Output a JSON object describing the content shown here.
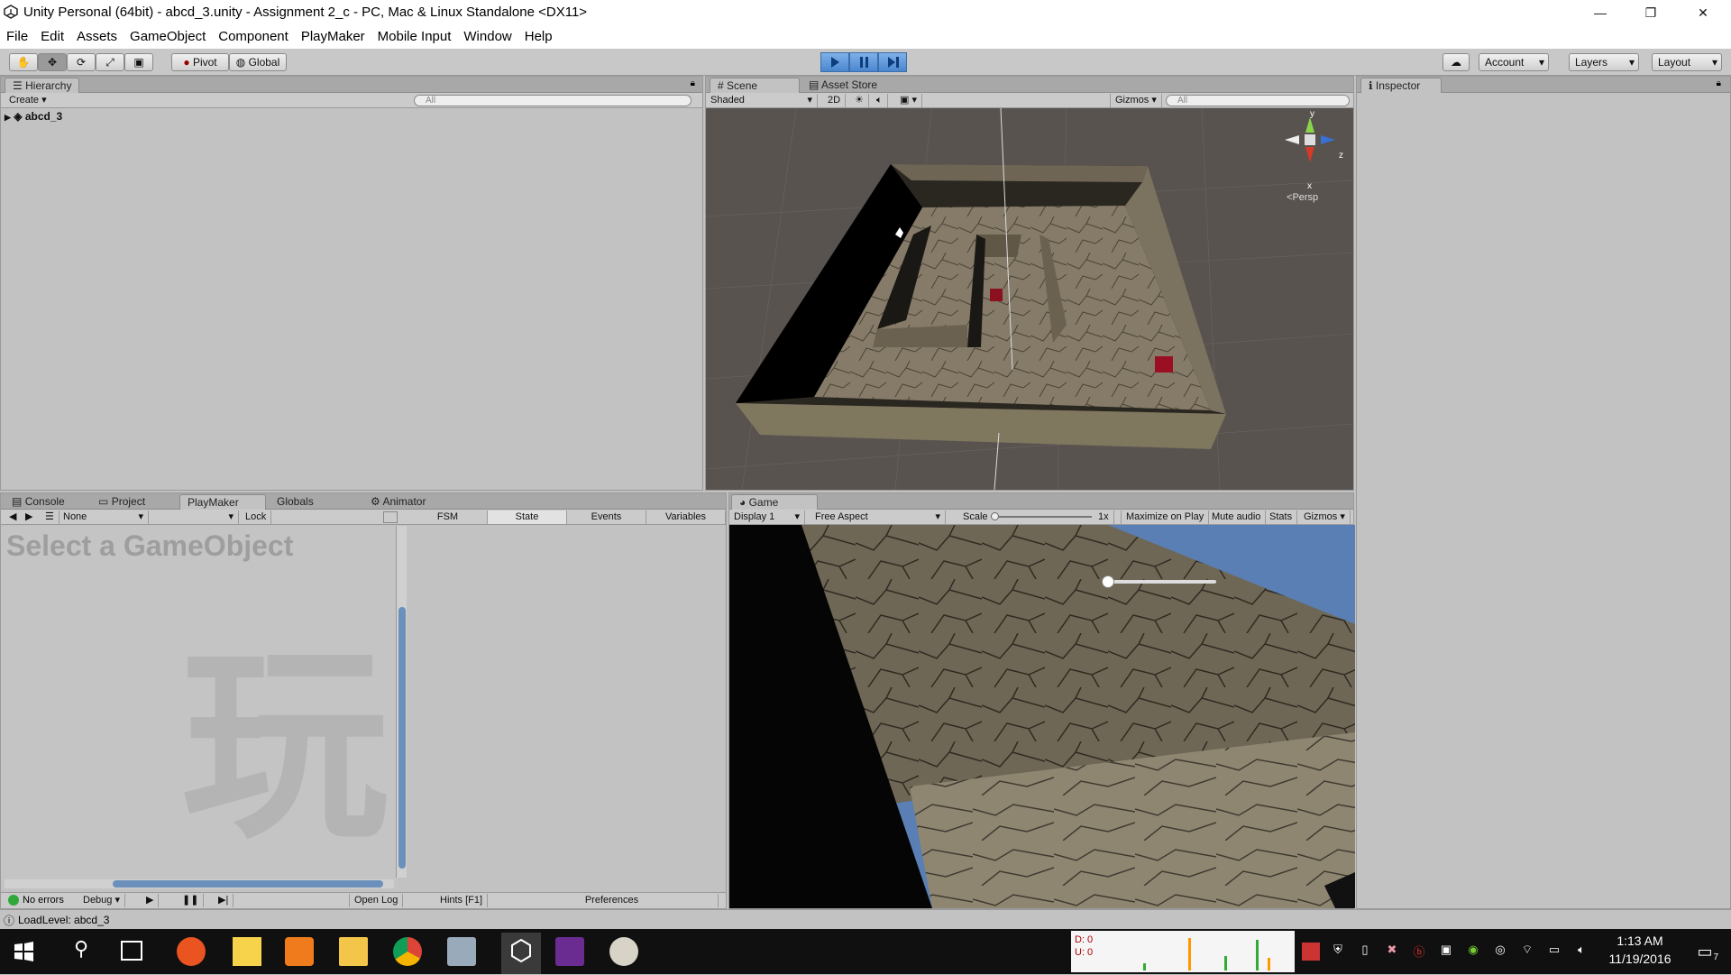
{
  "window": {
    "title": "Unity Personal (64bit) - abcd_3.unity - Assignment 2_c - PC, Mac & Linux Standalone <DX11>",
    "minimize": "—",
    "maximize": "❐",
    "close": "✕"
  },
  "menu": [
    "File",
    "Edit",
    "Assets",
    "GameObject",
    "Component",
    "PlayMaker",
    "Mobile Input",
    "Window",
    "Help"
  ],
  "toolbar": {
    "pivot": "Pivot",
    "global": "Global",
    "account": "Account",
    "layers": "Layers",
    "layout": "Layout"
  },
  "hierarchy": {
    "tab": "Hierarchy",
    "create": "Create",
    "search_placeholder": "All",
    "scene_name": "abcd_3"
  },
  "scene": {
    "tab": "Scene",
    "asset_store_tab": "Asset Store",
    "shading": "Shaded",
    "mode_2d": "2D",
    "gizmos": "Gizmos",
    "search_placeholder": "All",
    "persp": "Persp",
    "axis_y": "y",
    "axis_z": "z",
    "axis_x": "x"
  },
  "inspector": {
    "tab": "Inspector"
  },
  "bottom_tabs": {
    "console": "Console",
    "project": "Project",
    "playmaker": "PlayMaker",
    "globals": "Globals",
    "animator": "Animator"
  },
  "playmaker": {
    "fsm_dropdown": "None",
    "lock": "Lock",
    "placeholder": "Select a GameObject",
    "watermark": "玩",
    "tabs": [
      "FSM",
      "State",
      "Events",
      "Variables"
    ],
    "no_errors": "No errors",
    "debug": "Debug",
    "open_log": "Open Log",
    "hints": "Hints [F1]",
    "preferences": "Preferences"
  },
  "game": {
    "tab": "Game",
    "display": "Display 1",
    "aspect": "Free Aspect",
    "scale_label": "Scale",
    "scale_value": "1x",
    "maximize": "Maximize on Play",
    "mute": "Mute audio",
    "stats": "Stats",
    "gizmos": "Gizmos",
    "slider_value": 0.0
  },
  "status": {
    "message": "LoadLevel: abcd_3"
  },
  "taskbar": {
    "monitor_d": "D: 0",
    "monitor_u": "U: 0",
    "time": "1:13 AM",
    "date": "11/19/2016",
    "notifications": "7"
  },
  "colors": {
    "accent": "#4a86cf",
    "panel": "#c2c2c2",
    "sky": "#5a7fb5",
    "taskbar": "#101010"
  }
}
